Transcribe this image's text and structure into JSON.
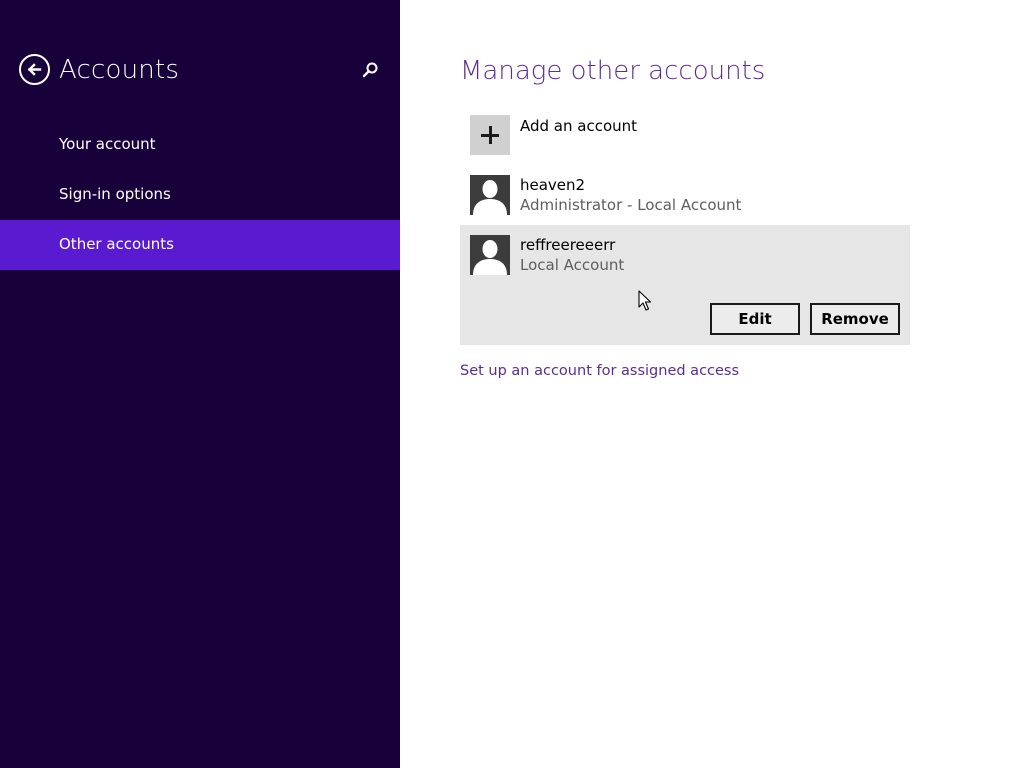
{
  "sidebar": {
    "title": "Accounts",
    "back_icon": "back-arrow-icon",
    "search_icon": "search-icon",
    "items": [
      {
        "label": "Your account",
        "active": false
      },
      {
        "label": "Sign-in options",
        "active": false
      },
      {
        "label": "Other accounts",
        "active": true
      }
    ],
    "colors": {
      "background": "#18003a",
      "active_item": "#5a1ad0"
    }
  },
  "main": {
    "title": "Manage other accounts",
    "add_account": {
      "label": "Add an account",
      "icon": "plus-icon"
    },
    "accounts": [
      {
        "name": "heaven2",
        "type": "Administrator - Local Account",
        "icon": "user-avatar-icon"
      },
      {
        "name": "reffreereeerr",
        "type": "Local Account",
        "icon": "user-avatar-icon",
        "selected": true
      }
    ],
    "actions": {
      "edit_label": "Edit",
      "remove_label": "Remove"
    },
    "assigned_access_link": "Set up an account for assigned access",
    "colors": {
      "accent": "#5c2d91",
      "selected_bg": "#e6e6e6"
    }
  }
}
